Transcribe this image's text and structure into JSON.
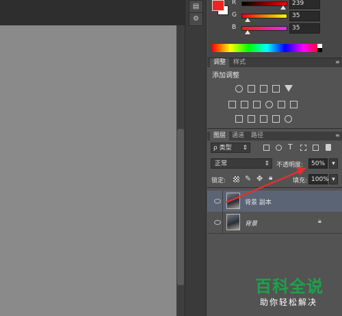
{
  "colors": {
    "foreground": "#ef2323",
    "background": "#ffffff",
    "canvas": "#8a8a8a",
    "arrow": "#e03030",
    "watermark_green": "#1aa34a"
  },
  "color_panel": {
    "channels": [
      {
        "label": "R",
        "value": "239",
        "gradient": "linear-gradient(to right,#000,#ff0000)",
        "level": 0.937
      },
      {
        "label": "G",
        "value": "35",
        "gradient": "linear-gradient(to right,#ef0000,#efff00)",
        "level": 0.137
      },
      {
        "label": "B",
        "value": "35",
        "gradient": "linear-gradient(to right,#ef2300,#ef23ff)",
        "level": 0.137
      }
    ]
  },
  "adjustments_panel": {
    "tabs": [
      "调整",
      "样式"
    ],
    "active_tab": "调整",
    "title": "添加调整",
    "icon_rows": [
      [
        "brightness-contrast-icon",
        "levels-icon",
        "curves-icon",
        "exposure-icon",
        "gradient-triangle-icon"
      ],
      [
        "vibrance-icon",
        "balance-icon",
        "black-white-icon",
        "photo-filter-icon",
        "channel-mixer-icon",
        "color-lookup-icon"
      ],
      [
        "invert-icon",
        "posterize-icon",
        "threshold-icon",
        "gradient-map-icon",
        "selective-color-icon"
      ]
    ]
  },
  "layers_panel": {
    "tabs": [
      "图层",
      "通道",
      "路径"
    ],
    "active_tab": "图层",
    "filter_label": "ρ 类型",
    "blend_mode": "正常",
    "opacity_label": "不透明度:",
    "opacity_value": "50%",
    "lock_label": "锁定:",
    "fill_label": "填充:",
    "fill_value": "100%",
    "layers": [
      {
        "name": "背景 副本",
        "selected": true,
        "italic": false,
        "locked": false
      },
      {
        "name": "背景",
        "selected": false,
        "italic": true,
        "locked": true
      }
    ]
  },
  "watermark": {
    "title": "百科全说",
    "subtitle": "助你轻松解决"
  }
}
